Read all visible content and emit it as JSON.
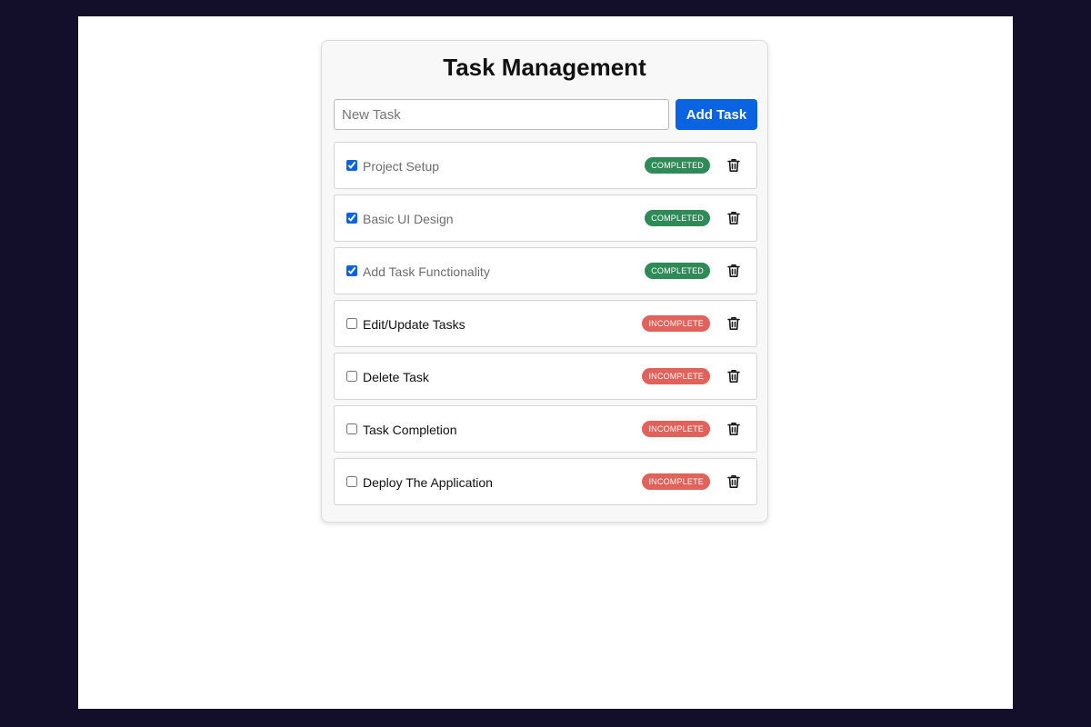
{
  "app": {
    "title": "Task Management"
  },
  "new_task": {
    "placeholder": "New Task",
    "value": ""
  },
  "toolbar": {
    "add_label": "Add Task"
  },
  "colors": {
    "accent": "#0a63e0",
    "completed": "#2e8b57",
    "incomplete": "#e0625b"
  },
  "icons": {
    "delete": "trash-icon"
  },
  "tasks": [
    {
      "label": "Project Setup",
      "status": "COMPLETED",
      "done": true
    },
    {
      "label": "Basic UI Design",
      "status": "COMPLETED",
      "done": true
    },
    {
      "label": "Add Task Functionality",
      "status": "COMPLETED",
      "done": true
    },
    {
      "label": "Edit/Update Tasks",
      "status": "INCOMPLETE",
      "done": false
    },
    {
      "label": "Delete Task",
      "status": "INCOMPLETE",
      "done": false
    },
    {
      "label": "Task Completion",
      "status": "INCOMPLETE",
      "done": false
    },
    {
      "label": "Deploy The Application",
      "status": "INCOMPLETE",
      "done": false
    }
  ]
}
